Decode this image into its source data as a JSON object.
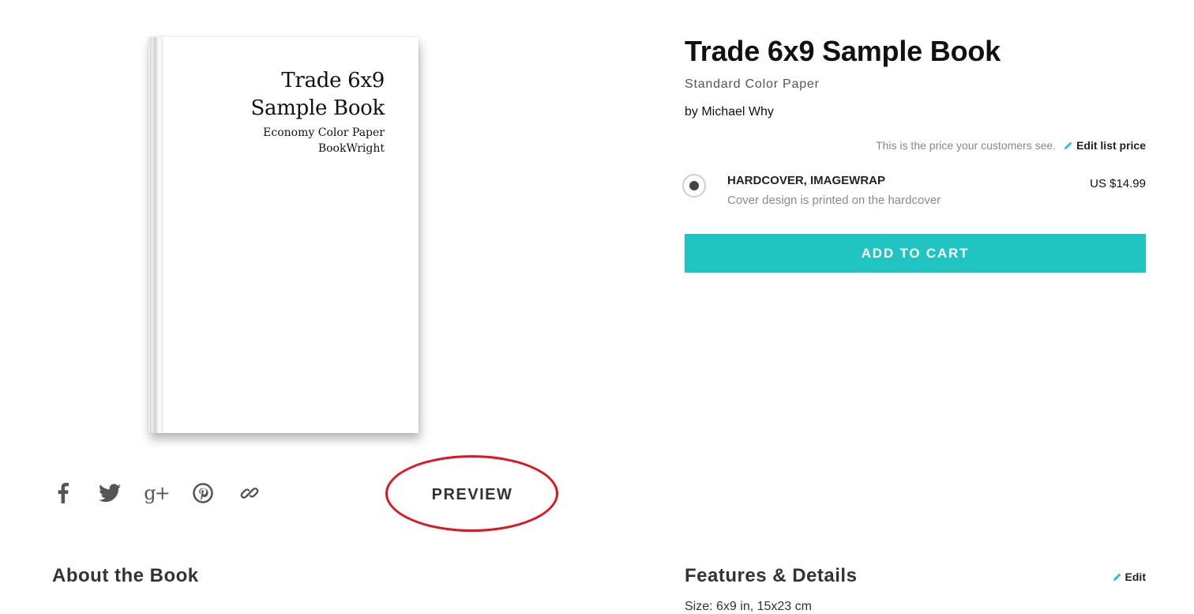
{
  "book": {
    "title_line1": "Trade 6x9",
    "title_line2": "Sample Book",
    "paper": "Economy Color Paper",
    "publisher": "BookWright"
  },
  "share": {
    "icons": [
      "facebook-icon",
      "twitter-icon",
      "google-plus-icon",
      "pinterest-icon",
      "link-icon"
    ],
    "google_plus_glyph": "g+"
  },
  "preview": {
    "label": "PREVIEW",
    "highlight_color": "#e0141e"
  },
  "product": {
    "title": "Trade 6x9 Sample Book",
    "paper_type": "Standard Color Paper",
    "author_line": "by Michael Why",
    "price_note": "This is the price your customers see.",
    "edit_price_label": "Edit list price",
    "option": {
      "name": "HARDCOVER, IMAGEWRAP",
      "description": "Cover design is printed on the hardcover",
      "price": "US $14.99",
      "selected": true
    },
    "add_to_cart_label": "ADD TO CART"
  },
  "sections": {
    "about_heading": "About the Book",
    "features_heading": "Features & Details",
    "features_edit_label": "Edit",
    "features_peek": "Size: 6x9 in, 15x23 cm"
  },
  "colors": {
    "accent": "#20c4c0",
    "text": "#222222",
    "muted": "#888888"
  }
}
